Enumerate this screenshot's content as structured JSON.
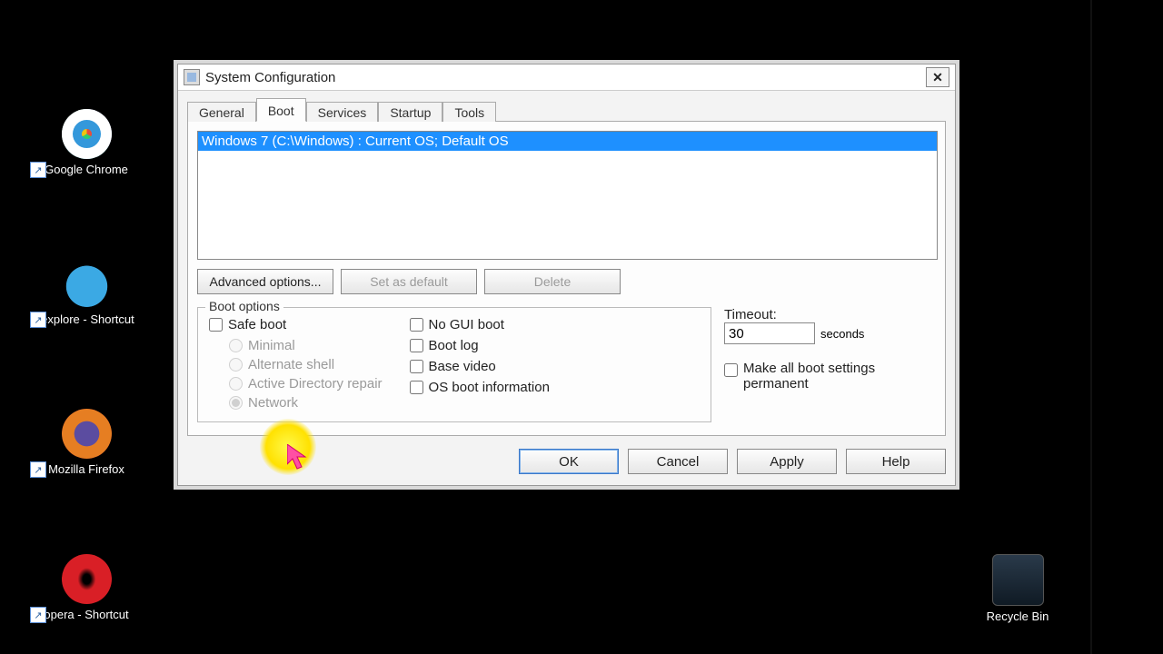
{
  "desktop_icons": {
    "chrome": "Google Chrome",
    "ie": "iexplore - Shortcut",
    "firefox": "Mozilla Firefox",
    "opera": "opera - Shortcut",
    "recycle": "Recycle Bin"
  },
  "dialog": {
    "title": "System Configuration",
    "tabs": {
      "general": "General",
      "boot": "Boot",
      "services": "Services",
      "startup": "Startup",
      "tools": "Tools"
    },
    "oslist": {
      "entry0": "Windows 7 (C:\\Windows) : Current OS; Default OS"
    },
    "buttons": {
      "advanced": "Advanced options...",
      "set_default": "Set as default",
      "delete": "Delete"
    },
    "boot_options": {
      "legend": "Boot options",
      "safe_boot": "Safe boot",
      "minimal": "Minimal",
      "alt_shell": "Alternate shell",
      "ad_repair": "Active Directory repair",
      "network": "Network",
      "no_gui": "No GUI boot",
      "boot_log": "Boot log",
      "base_video": "Base video",
      "os_boot_info": "OS boot information"
    },
    "timeout": {
      "label": "Timeout:",
      "value": "30",
      "unit": "seconds"
    },
    "permanent": "Make all boot settings permanent",
    "actions": {
      "ok": "OK",
      "cancel": "Cancel",
      "apply": "Apply",
      "help": "Help"
    }
  }
}
